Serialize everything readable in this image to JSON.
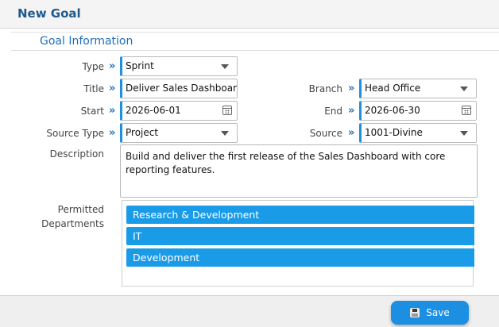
{
  "header": {
    "title": "New Goal"
  },
  "section": {
    "title": "Goal Information"
  },
  "fields": {
    "type": {
      "label": "Type",
      "value": "Sprint"
    },
    "title": {
      "label": "Title",
      "value": "Deliver Sales Dashboard"
    },
    "branch": {
      "label": "Branch",
      "value": "Head Office"
    },
    "start": {
      "label": "Start",
      "value": "2026-06-01"
    },
    "end": {
      "label": "End",
      "value": "2026-06-30"
    },
    "source_type": {
      "label": "Source Type",
      "value": "Project"
    },
    "source": {
      "label": "Source",
      "value": "1001-Divine"
    },
    "description": {
      "label": "Description",
      "value": "Build and deliver the first release of the Sales Dashboard with core reporting features."
    },
    "departments": {
      "label_line1": "Permitted",
      "label_line2": "Departments",
      "items": [
        "Research & Development",
        "IT",
        "Development"
      ]
    }
  },
  "icons": {
    "arrow": "»",
    "calendar": "calendar-icon",
    "dropdown": "chevron-down-icon",
    "save": "floppy-disk-icon"
  },
  "footer": {
    "save_label": "Save"
  },
  "colors": {
    "accent": "#1f8fe0",
    "title": "#1f5a8e",
    "department_bar": "#1a9be8",
    "save_button": "#1c8fe3"
  }
}
